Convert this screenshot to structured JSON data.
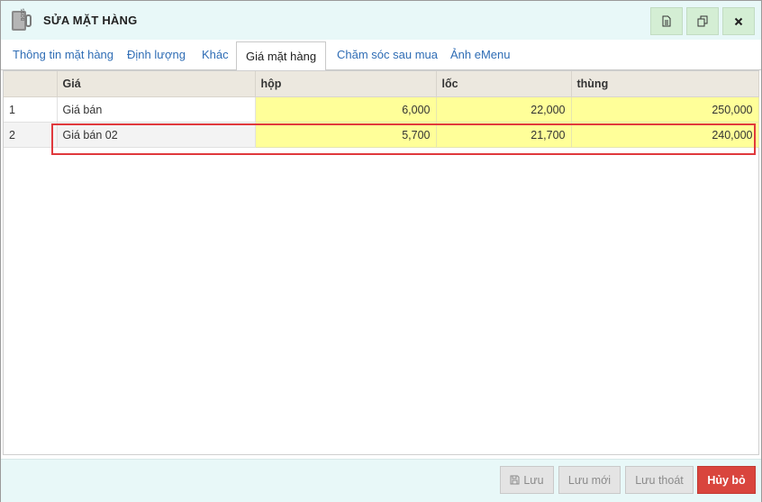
{
  "window": {
    "title": "SỬA MẶT HÀNG",
    "app_icon": "boss-app-icon"
  },
  "toolbar": {
    "icons": [
      "document-icon",
      "copy-icon",
      "close-icon"
    ]
  },
  "tabs": [
    {
      "label": "Thông tin mặt hàng"
    },
    {
      "label": "Định lượng"
    },
    {
      "label": "Khác"
    },
    {
      "label": "Giá mặt hàng",
      "active": true
    },
    {
      "label": "Chăm sóc sau mua"
    },
    {
      "label": "Ảnh eMenu"
    }
  ],
  "grid": {
    "headers": [
      "",
      "Giá",
      "hộp",
      "lốc",
      "thùng"
    ],
    "rows": [
      {
        "idx": "1",
        "name": "Giá bán",
        "hop": "6,000",
        "loc": "22,000",
        "thung": "250,000"
      },
      {
        "idx": "2",
        "name": "Giá bán 02",
        "hop": "5,700",
        "loc": "21,700",
        "thung": "240,000"
      }
    ]
  },
  "footer": {
    "save": "Lưu",
    "save_new": "Lưu mới",
    "save_exit": "Lưu thoát",
    "cancel": "Hủy bỏ"
  },
  "colors": {
    "accent_tab": "#2f6db5",
    "price_cell": "#ffff99",
    "cancel_button": "#d9453d",
    "highlight_box": "#e0393d"
  }
}
